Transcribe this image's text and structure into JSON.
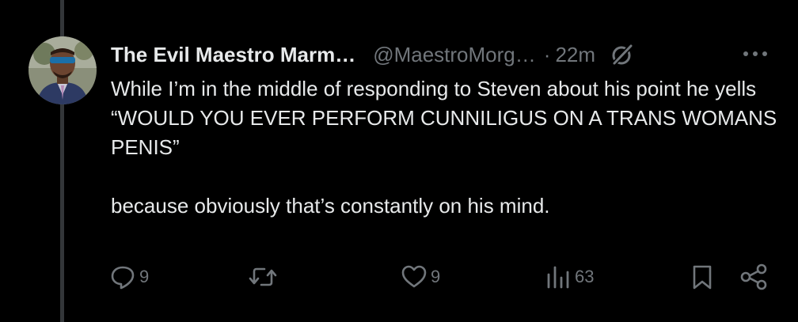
{
  "tweet": {
    "display_name": "The Evil Maestro Marm…",
    "handle": "@MaestroMorg…",
    "separator": "·",
    "time": "22m",
    "text": "While I’m in the middle of responding to Steven about his point he yells “WOULD YOU EVER PERFORM CUNNILIGUS ON A TRANS WOMANS PENIS”\n\nbecause obviously that’s constantly on his mind."
  },
  "actions": {
    "replies": "9",
    "likes": "9",
    "views": "63"
  },
  "icons": {
    "header": [
      "grok-icon",
      "more-icon"
    ],
    "actions": [
      "reply-icon",
      "retweet-icon",
      "like-icon",
      "views-icon",
      "bookmark-icon",
      "share-icon"
    ]
  },
  "colors": {
    "background": "#000000",
    "text_primary": "#e7e9ea",
    "text_secondary": "#71767b",
    "thread_line": "#333639"
  }
}
